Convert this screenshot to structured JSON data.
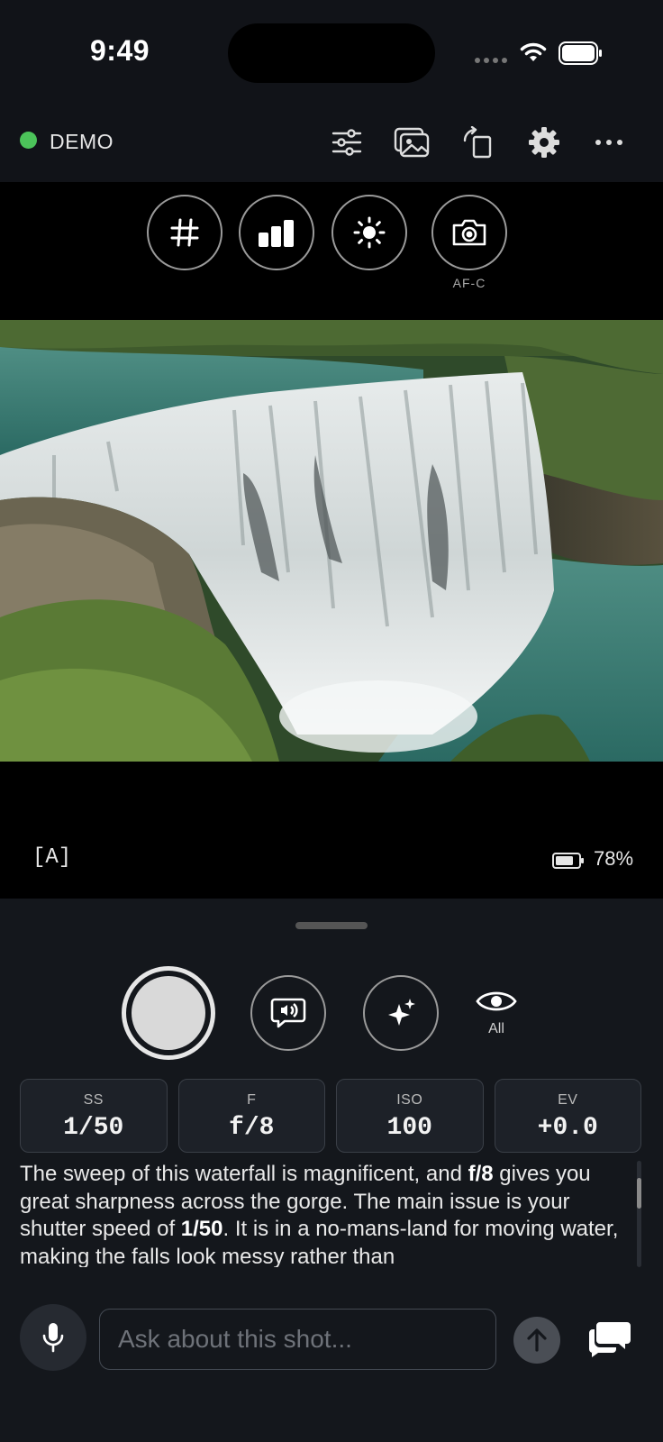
{
  "status_bar": {
    "time": "9:49"
  },
  "toolbar": {
    "connection_label": "DEMO",
    "connection_color": "#4cc35a",
    "icons": [
      "sliders-icon",
      "gallery-icon",
      "rotate-icon",
      "gear-icon",
      "more-icon"
    ]
  },
  "quick_tools": {
    "buttons": [
      "grid-icon",
      "histogram-icon",
      "brightness-icon",
      "focus-icon"
    ],
    "focus_label": "AF-C"
  },
  "viewfinder": {
    "mode_tag": "[A]",
    "battery_percent": "78%",
    "battery_level": 0.78
  },
  "controls": {
    "voice_feedback_icon": "speaker-bubble-icon",
    "ai_icon": "sparkles-icon",
    "visibility_label": "All"
  },
  "params": [
    {
      "label": "SS",
      "value": "1/50"
    },
    {
      "label": "F",
      "value": "f/8"
    },
    {
      "label": "ISO",
      "value": "100"
    },
    {
      "label": "EV",
      "value": "+0.0"
    }
  ],
  "feedback": {
    "seg1": "The sweep of this waterfall is magnificent, and ",
    "bold1": "f/8",
    "seg2": " gives you great sharpness across the gorge. The main issue is your shutter speed of ",
    "bold2": "1/50",
    "seg3": ". It is in a no-mans-land for moving water, making the falls look messy rather than"
  },
  "chat": {
    "placeholder": "Ask about this shot..."
  }
}
